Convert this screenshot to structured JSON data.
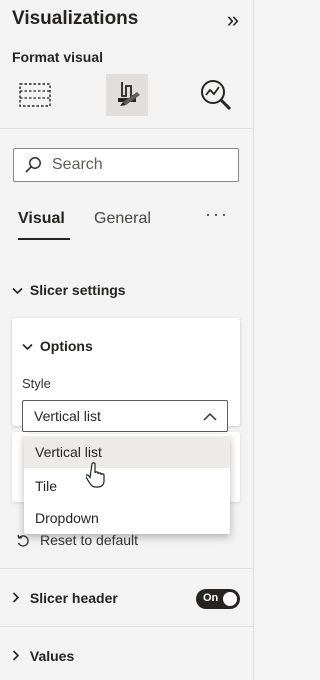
{
  "pane": {
    "title": "Visualizations",
    "collapse_glyph": "»",
    "subtitle": "Format visual"
  },
  "icons": {
    "fields": "build-visual-icon",
    "format": "format-visual-icon",
    "analytics": "analytics-icon"
  },
  "search": {
    "placeholder": "Search"
  },
  "tabs": {
    "visual": "Visual",
    "general": "General",
    "more": "···"
  },
  "sections": {
    "slicer_settings": "Slicer settings",
    "options": "Options",
    "style_label": "Style",
    "style_value": "Vertical list",
    "style_options": [
      "Vertical list",
      "Tile",
      "Dropdown"
    ],
    "reset": "Reset to default",
    "slicer_header": "Slicer header",
    "values": "Values"
  },
  "toggle": {
    "label": "On",
    "state": "on"
  },
  "colors": {
    "pane_bg": "#f3f3f3",
    "text": "#252423",
    "selected_option_bg": "#edebe9",
    "toggle_bg": "#252423"
  }
}
